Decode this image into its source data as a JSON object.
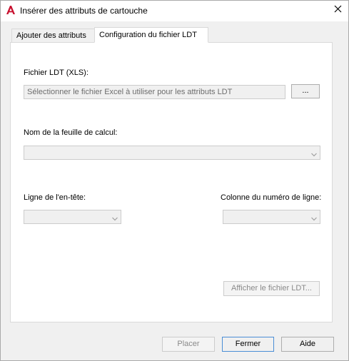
{
  "window": {
    "title": "Insérer des attributs de cartouche",
    "icons": {
      "app": "autocad-a-icon",
      "close": "close-icon"
    },
    "accent_color": "#c8102e"
  },
  "tabs": [
    {
      "label": "Ajouter des attributs",
      "active": false
    },
    {
      "label": "Configuration du fichier LDT",
      "active": true
    }
  ],
  "config": {
    "ldt_file_label": "Fichier LDT (XLS):",
    "ldt_file_placeholder": "Sélectionner le fichier Excel à utiliser pour les attributs LDT",
    "browse_label": "...",
    "sheet_label": "Nom de la feuille de calcul:",
    "sheet_value": "",
    "header_row_label": "Ligne de l'en-tête:",
    "header_row_value": "",
    "row_number_col_label": "Colonne du numéro de ligne:",
    "row_number_col_value": "",
    "show_ldt_label": "Afficher le fichier LDT..."
  },
  "footer": {
    "place_label": "Placer",
    "close_label": "Fermer",
    "help_label": "Aide"
  }
}
